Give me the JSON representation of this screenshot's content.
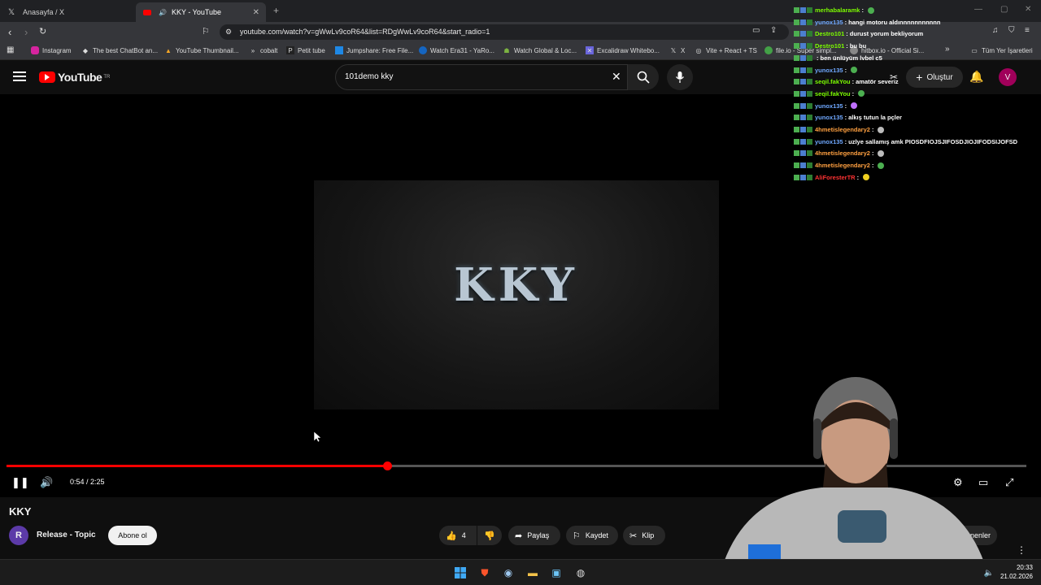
{
  "browser": {
    "tabs": [
      {
        "label": "Anasayfa / X",
        "active": false
      },
      {
        "label": "KKY - YouTube",
        "active": true
      }
    ],
    "url": "youtube.com/watch?v=gWwLv9coR64&list=RDgWwLv9coR64&start_radio=1",
    "bookmarks": [
      "Instagram",
      "The best ChatBot an...",
      "YouTube Thumbnail...",
      "cobalt",
      "Petit tube",
      "Jumpshare: Free File...",
      "Watch Era31 - YaRo...",
      "Watch Global & Loc...",
      "Excalidraw Whitebo...",
      "X",
      "Vite + React + TS",
      "file.io - Super simpl...",
      "hitbox.io - Official Si..."
    ],
    "all_bookmarks": "Tüm Yer İşaretleri"
  },
  "youtube": {
    "logo_text": "YouTube",
    "logo_region": "TR",
    "search_query": "101demo kky",
    "create_label": "Oluştur",
    "avatar_letter": "V"
  },
  "player": {
    "overlay_title": "KKY",
    "time": "0:54 / 2:25",
    "progress": 0.373
  },
  "video": {
    "title": "KKY",
    "channel_initial": "R",
    "channel_name": "Release - Topic",
    "subscribe_label": "Abone ol",
    "likes": "4",
    "share_label": "Paylaş",
    "save_label": "Kaydet",
    "clip_label": "Klip",
    "partial_label": "enenler"
  },
  "chat": [
    {
      "user": "merhabalaramk",
      "text": "",
      "color": "#7cfc00",
      "emote": "#4caf50"
    },
    {
      "user": "yunox135",
      "text": "hangi motoru aldınnnnnnnnnnn",
      "color": "#6fa8ff"
    },
    {
      "user": "Destro101",
      "text": "durust yorum bekliyorum",
      "color": "#7cfc00"
    },
    {
      "user": "Destro101",
      "text": "bu bu",
      "color": "#7cfc00"
    },
    {
      "user": "",
      "text": "ben ünlüyüm lvbel c5",
      "color": "#ff4444"
    },
    {
      "user": "yunox135",
      "text": "",
      "color": "#6fa8ff",
      "emote": "#4caf50"
    },
    {
      "user": "seqil.fakYou",
      "text": "amatör severiz",
      "color": "#7cfc00"
    },
    {
      "user": "seqil.fakYou",
      "text": "",
      "color": "#7cfc00",
      "emote": "#4caf50"
    },
    {
      "user": "yunox135",
      "text": "",
      "color": "#6fa8ff",
      "emote": "#c070ff"
    },
    {
      "user": "yunox135",
      "text": "alkış tutun la pçler",
      "color": "#6fa8ff"
    },
    {
      "user": "4hmetislegendary2",
      "text": "",
      "color": "#ffa040",
      "emote": "#bbbbbb"
    },
    {
      "user": "yunox135",
      "text": "uzlye sallamış amk PIOSDFIOJSJIFOSDJIOJIFODSIJOFSD",
      "color": "#6fa8ff"
    },
    {
      "user": "4hmetislegendary2",
      "text": "",
      "color": "#ffa040",
      "emote": "#bbbbbb"
    },
    {
      "user": "4hmetislegendary2",
      "text": "",
      "color": "#ffa040",
      "emote": "#4caf50"
    },
    {
      "user": "AliForesterTR",
      "text": "",
      "color": "#ff3333",
      "emote": "#f0d020"
    }
  ],
  "clock": {
    "time": "20:33",
    "date": "21.02.2026"
  }
}
